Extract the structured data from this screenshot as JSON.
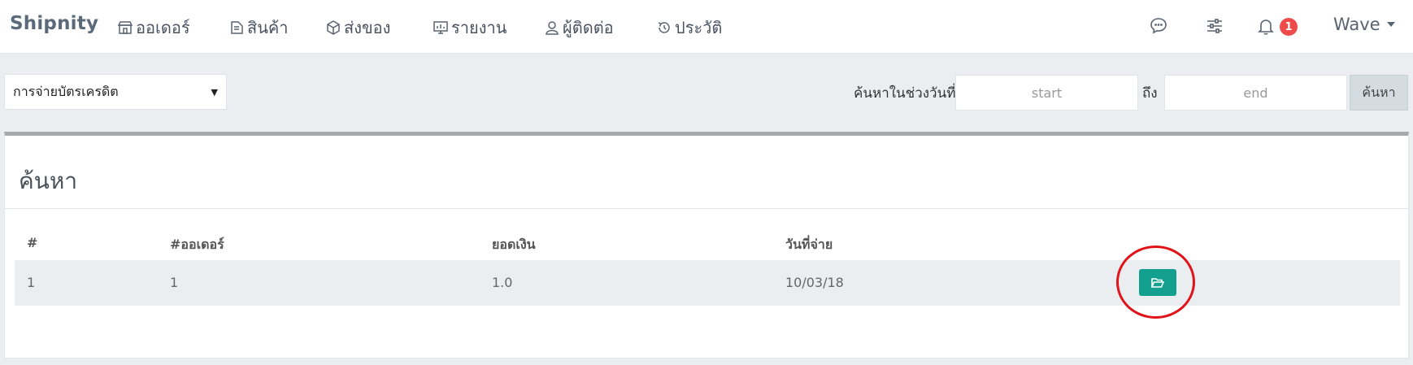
{
  "navbar": {
    "brand": "Shipnity",
    "items": [
      {
        "label": "ออเดอร์",
        "icon": "store-icon"
      },
      {
        "label": "สินค้า",
        "icon": "tag-icon"
      },
      {
        "label": "ส่งของ",
        "icon": "box-icon"
      },
      {
        "label": "รายงาน",
        "icon": "monitor-chart-icon"
      },
      {
        "label": "ผู้ติดต่อ",
        "icon": "user-icon"
      },
      {
        "label": "ประวัติ",
        "icon": "history-icon"
      }
    ],
    "right_icons": [
      "chat-icon",
      "settings-sliders-icon",
      "bell-icon"
    ],
    "notification_count": "1",
    "user_name": "Wave"
  },
  "filter": {
    "select_value": "การจ่ายบัตรเครดิต",
    "range_label": "ค้นหาในช่วงวันที่",
    "to_label": "ถึง",
    "start_placeholder": "start",
    "end_placeholder": "end",
    "search_button": "ค้นหา"
  },
  "panel": {
    "title": "ค้นหา",
    "columns": [
      "#",
      "#ออเดอร์",
      "ยอดเงิน",
      "วันที่จ่าย"
    ],
    "rows": [
      {
        "index": "1",
        "order": "1",
        "amount": "1.0",
        "date": "10/03/18",
        "action_icon": "folder-open-icon"
      }
    ]
  },
  "colors": {
    "action_button": "#13a08e",
    "badge": "#ef4b4b",
    "highlight": "#e0131a"
  }
}
